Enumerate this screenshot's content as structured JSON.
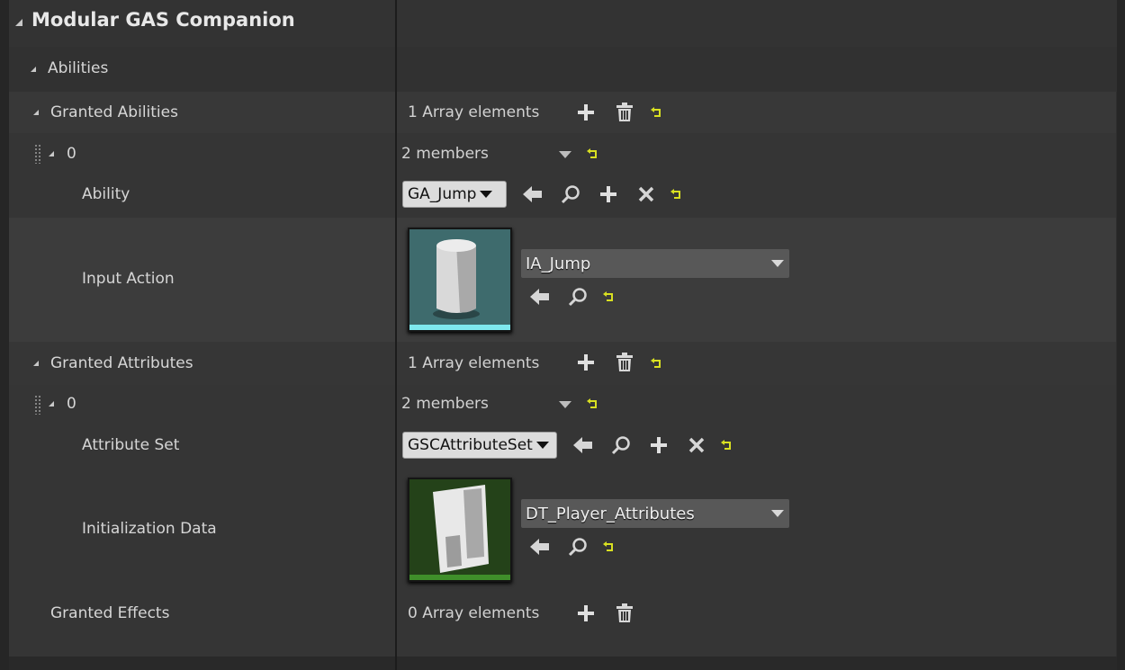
{
  "category": {
    "title": "Modular GAS Companion",
    "subcategory": "Abilities"
  },
  "granted_abilities": {
    "label": "Granted Abilities",
    "count_text": "1 Array elements",
    "element": {
      "index": "0",
      "members_text": "2 members",
      "ability": {
        "label": "Ability",
        "value": "GA_Jump"
      },
      "input_action": {
        "label": "Input Action",
        "asset": "IA_Jump"
      }
    }
  },
  "granted_attributes": {
    "label": "Granted Attributes",
    "count_text": "1 Array elements",
    "element": {
      "index": "0",
      "members_text": "2 members",
      "attribute_set": {
        "label": "Attribute Set",
        "value": "GSCAttributeSet"
      },
      "initialization_data": {
        "label": "Initialization Data",
        "asset": "DT_Player_Attributes"
      }
    }
  },
  "granted_effects": {
    "label": "Granted Effects",
    "count_text": "0 Array elements"
  },
  "colors": {
    "panel_bg": "#2f2f2f",
    "row_highlight": "#3a3a3a",
    "reset_arrow": "#d9e021",
    "input_action_accent": "#7ee8ee",
    "data_table_accent": "#3f8f2a"
  },
  "icons": [
    "plus-icon",
    "trash-icon",
    "reset-icon",
    "use-selected-icon",
    "browse-icon",
    "clear-icon",
    "dropdown-caret-icon"
  ]
}
